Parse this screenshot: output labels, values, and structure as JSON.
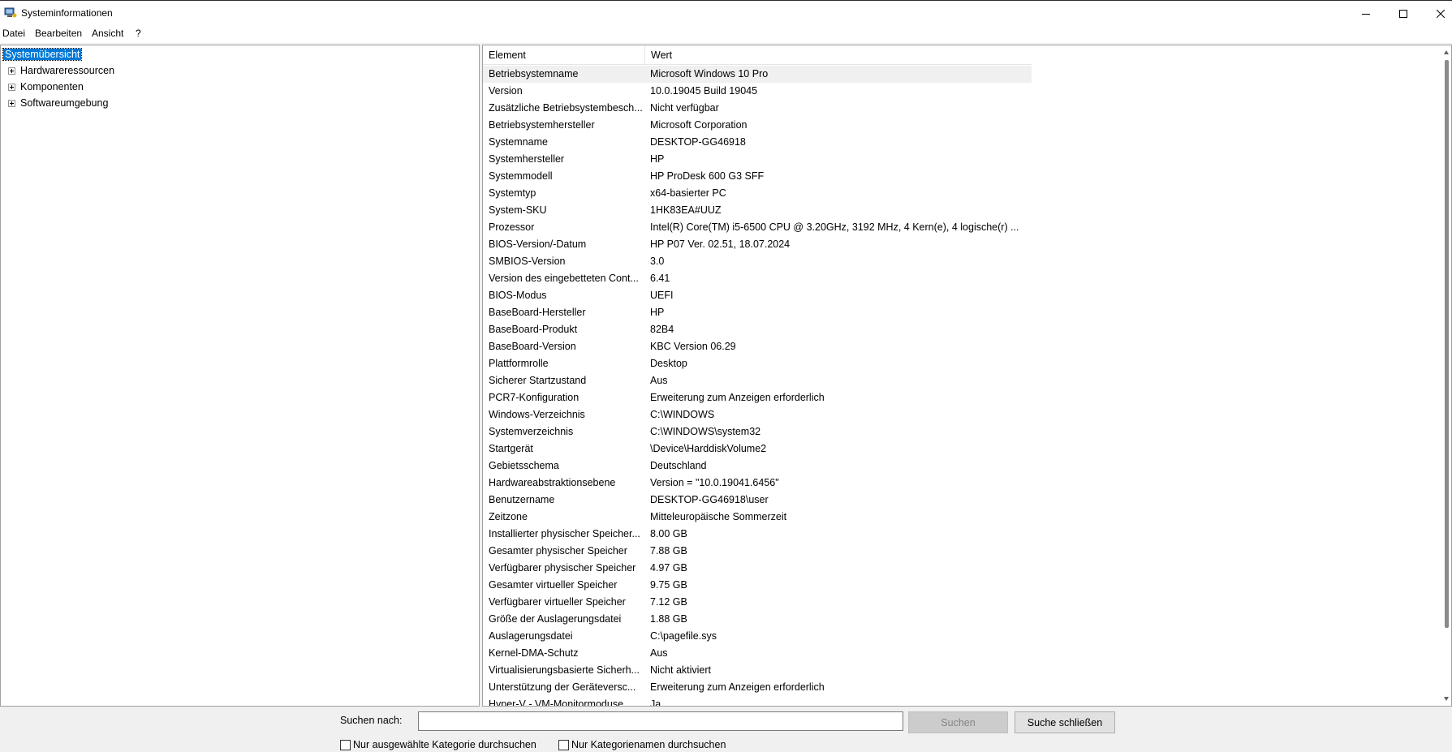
{
  "window": {
    "title": "Systeminformationen",
    "icon": "system-info-icon"
  },
  "menu": [
    "Datei",
    "Bearbeiten",
    "Ansicht",
    "?"
  ],
  "tree": [
    {
      "label": "Systemübersicht",
      "selected": true,
      "expandable": false
    },
    {
      "label": "Hardwareressourcen",
      "selected": false,
      "expandable": true
    },
    {
      "label": "Komponenten",
      "selected": false,
      "expandable": true
    },
    {
      "label": "Softwareumgebung",
      "selected": false,
      "expandable": true
    }
  ],
  "list": {
    "columns": [
      "Element",
      "Wert"
    ],
    "rows": [
      [
        "Betriebsystemname",
        "Microsoft Windows 10 Pro"
      ],
      [
        "Version",
        "10.0.19045 Build 19045"
      ],
      [
        "Zusätzliche Betriebsystembesch...",
        "Nicht verfügbar"
      ],
      [
        "Betriebsystemhersteller",
        "Microsoft Corporation"
      ],
      [
        "Systemname",
        "DESKTOP-GG46918"
      ],
      [
        "Systemhersteller",
        "HP"
      ],
      [
        "Systemmodell",
        "HP ProDesk 600 G3 SFF"
      ],
      [
        "Systemtyp",
        "x64-basierter PC"
      ],
      [
        "System-SKU",
        "1HK83EA#UUZ"
      ],
      [
        "Prozessor",
        "Intel(R) Core(TM) i5-6500 CPU @ 3.20GHz, 3192 MHz, 4 Kern(e), 4 logische(r) ..."
      ],
      [
        "BIOS-Version/-Datum",
        "HP P07 Ver. 02.51, 18.07.2024"
      ],
      [
        "SMBIOS-Version",
        "3.0"
      ],
      [
        "Version des eingebetteten Cont...",
        "6.41"
      ],
      [
        "BIOS-Modus",
        "UEFI"
      ],
      [
        "BaseBoard-Hersteller",
        "HP"
      ],
      [
        "BaseBoard-Produkt",
        "82B4"
      ],
      [
        "BaseBoard-Version",
        "KBC Version 06.29"
      ],
      [
        "Plattformrolle",
        "Desktop"
      ],
      [
        "Sicherer Startzustand",
        "Aus"
      ],
      [
        "PCR7-Konfiguration",
        "Erweiterung zum Anzeigen erforderlich"
      ],
      [
        "Windows-Verzeichnis",
        "C:\\WINDOWS"
      ],
      [
        "Systemverzeichnis",
        "C:\\WINDOWS\\system32"
      ],
      [
        "Startgerät",
        "\\Device\\HarddiskVolume2"
      ],
      [
        "Gebietsschema",
        "Deutschland"
      ],
      [
        "Hardwareabstraktionsebene",
        "Version = \"10.0.19041.6456\""
      ],
      [
        "Benutzername",
        "DESKTOP-GG46918\\user"
      ],
      [
        "Zeitzone",
        "Mitteleuropäische Sommerzeit"
      ],
      [
        "Installierter physischer Speicher...",
        "8.00 GB"
      ],
      [
        "Gesamter physischer Speicher",
        "7.88 GB"
      ],
      [
        "Verfügbarer physischer Speicher",
        "4.97 GB"
      ],
      [
        "Gesamter virtueller Speicher",
        "9.75 GB"
      ],
      [
        "Verfügbarer virtueller Speicher",
        "7.12 GB"
      ],
      [
        "Größe der Auslagerungsdatei",
        "1.88 GB"
      ],
      [
        "Auslagerungsdatei",
        "C:\\pagefile.sys"
      ],
      [
        "Kernel-DMA-Schutz",
        "Aus"
      ],
      [
        "Virtualisierungsbasierte Sicherh...",
        "Nicht aktiviert"
      ],
      [
        "Unterstützung der Geräteversc...",
        "Erweiterung zum Anzeigen erforderlich"
      ],
      [
        "Hyper-V - VM-Monitormoduse...",
        "Ja"
      ]
    ]
  },
  "search": {
    "label": "Suchen nach:",
    "value": "",
    "search_button": "Suchen",
    "stop_button": "Suche schließen",
    "only_selected_category": "Nur ausgewählte Kategorie durchsuchen",
    "only_category_names": "Nur Kategorienamen durchsuchen"
  },
  "colors": {
    "selection": "#0078d7",
    "highlight_row": "#f0f0f0",
    "border": "#a0a0a0"
  }
}
